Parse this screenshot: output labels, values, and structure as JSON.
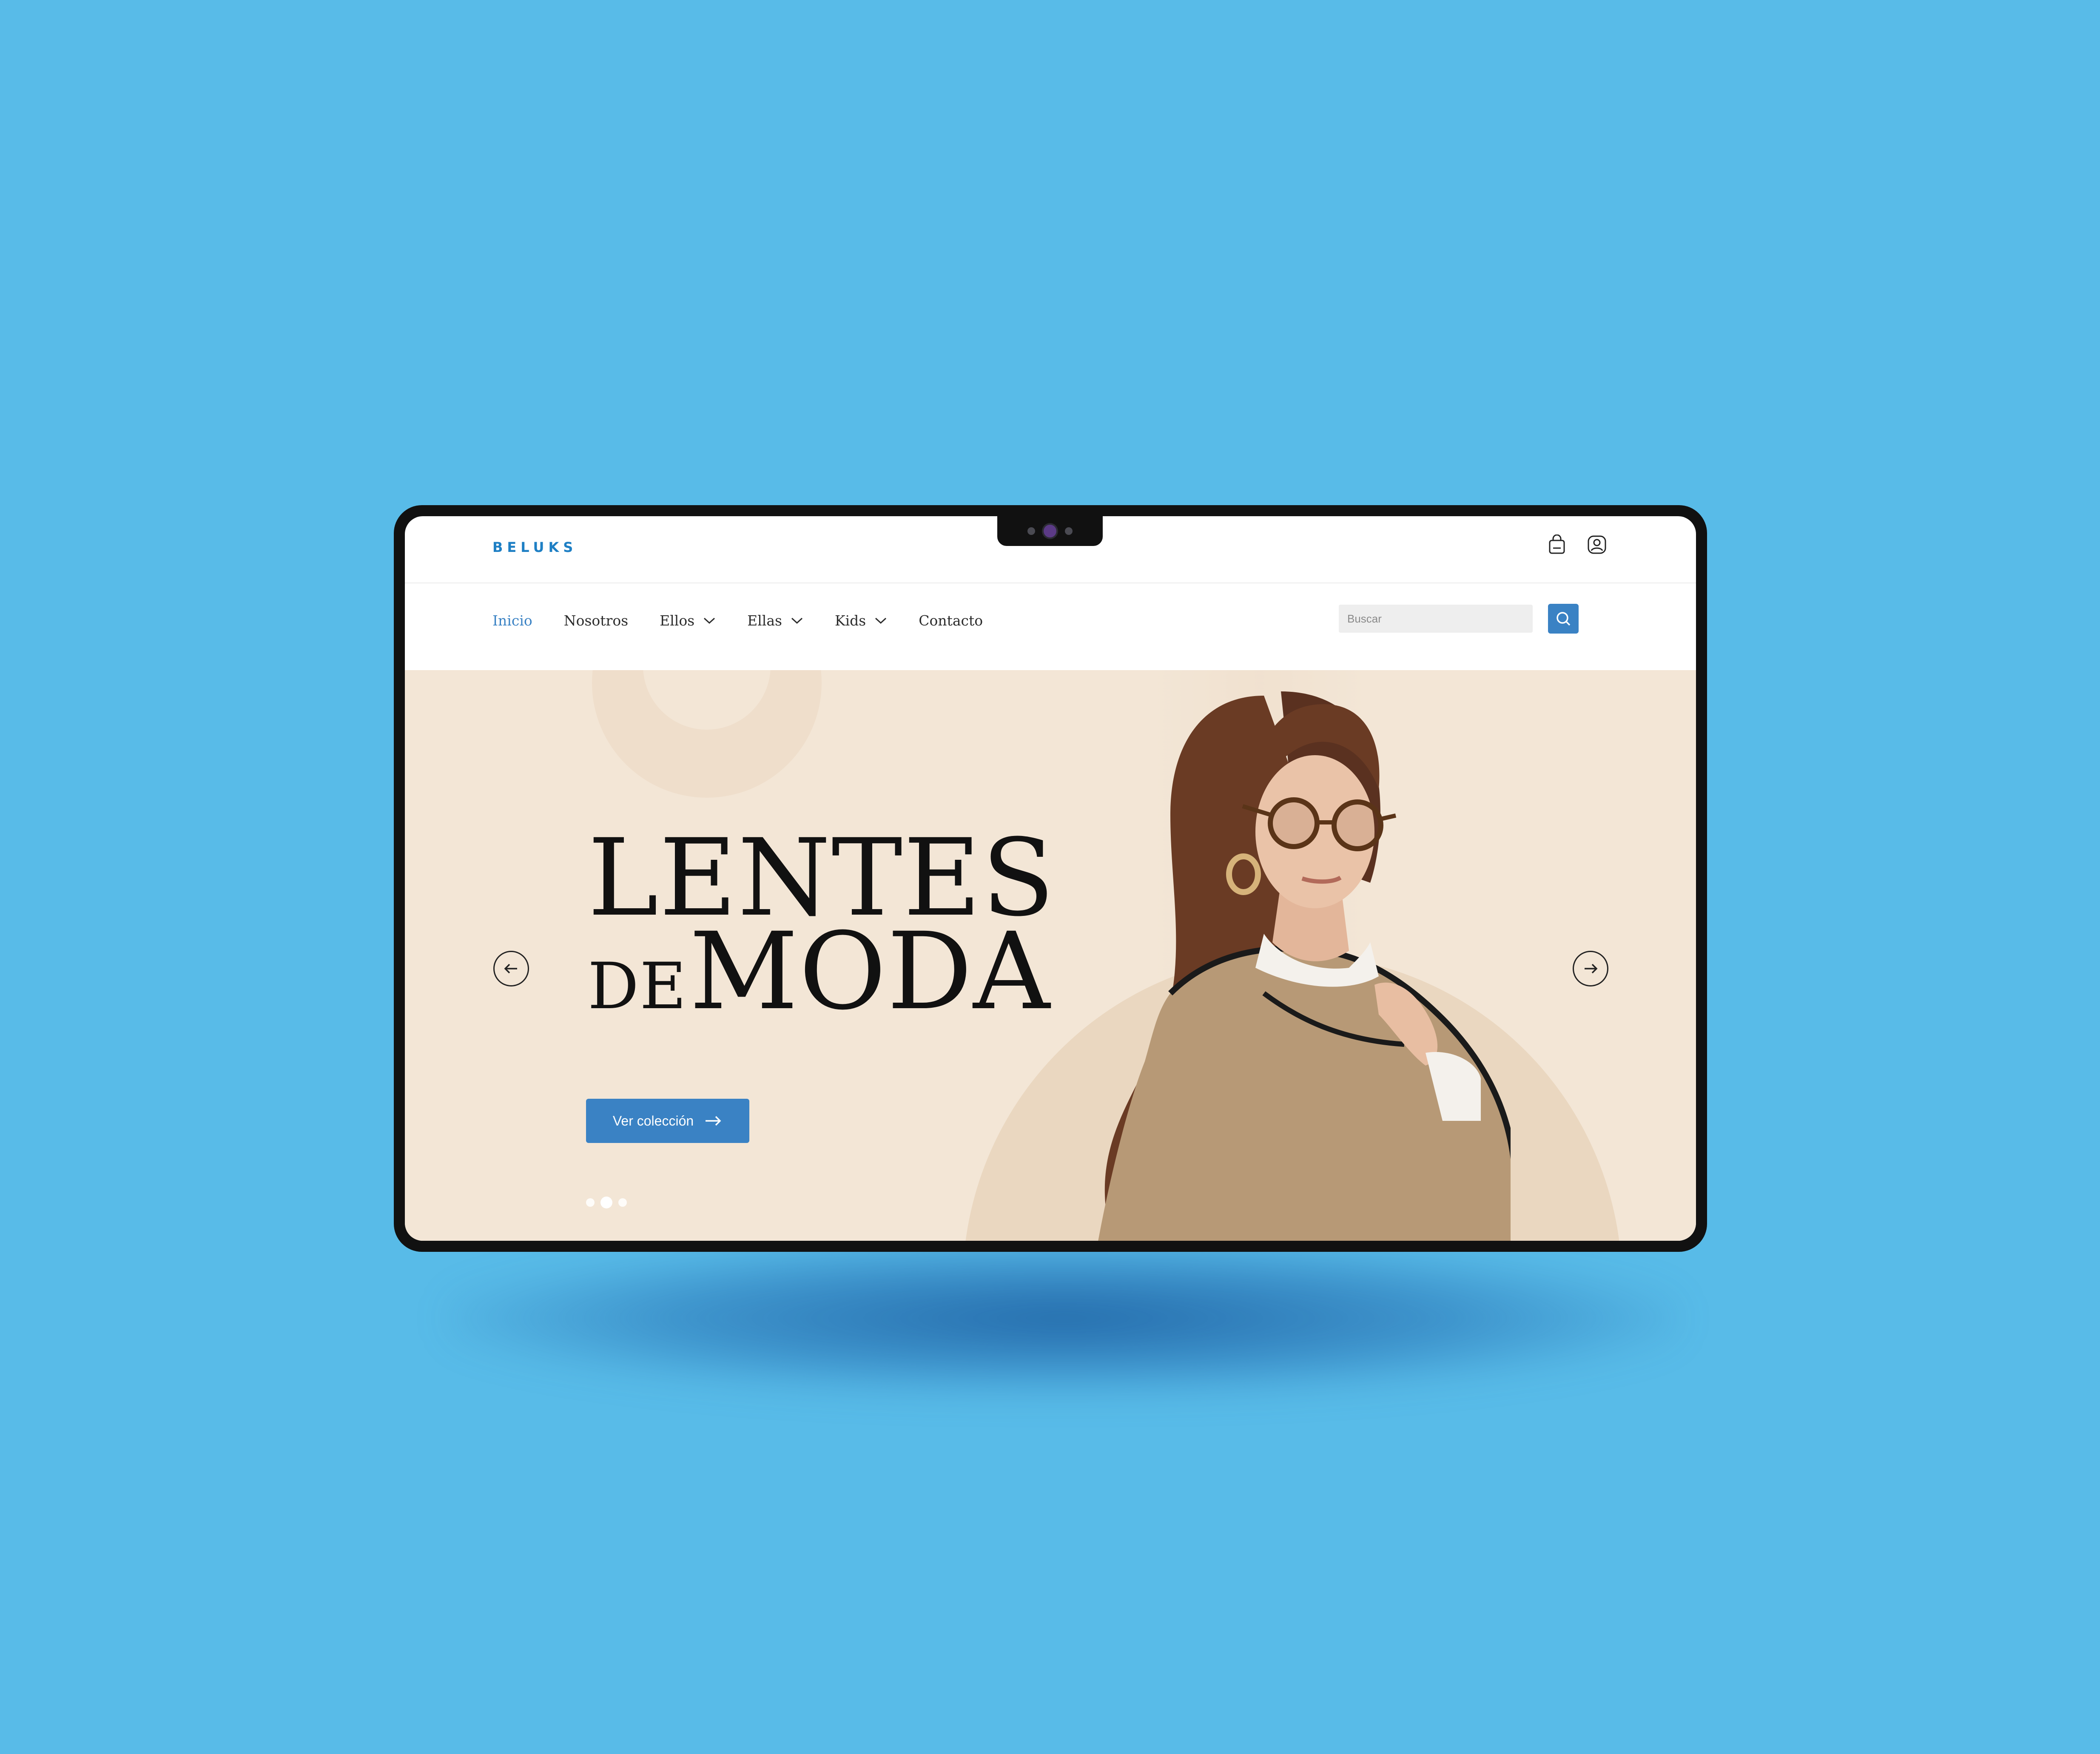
{
  "brand": {
    "logo": "BELUKS",
    "accent_color": "#3a82c4",
    "background_color": "#58bbe8"
  },
  "topbar": {
    "icons": [
      "bag-icon",
      "user-icon"
    ]
  },
  "nav": {
    "items": [
      {
        "label": "Inicio",
        "active": true,
        "dropdown": false
      },
      {
        "label": "Nosotros",
        "active": false,
        "dropdown": false
      },
      {
        "label": "Ellos",
        "active": false,
        "dropdown": true
      },
      {
        "label": "Ellas",
        "active": false,
        "dropdown": true
      },
      {
        "label": "Kids",
        "active": false,
        "dropdown": true
      },
      {
        "label": "Contacto",
        "active": false,
        "dropdown": false
      }
    ]
  },
  "search": {
    "placeholder": "Buscar",
    "value": "",
    "icon": "search-icon"
  },
  "hero": {
    "headline_line1": "LENTES",
    "headline_small": "DE",
    "headline_large": "MODA",
    "cta_label": "Ver colección",
    "slides": {
      "count": 3,
      "active_index": 1
    },
    "hero_bg_color": "#f3e6d6"
  }
}
